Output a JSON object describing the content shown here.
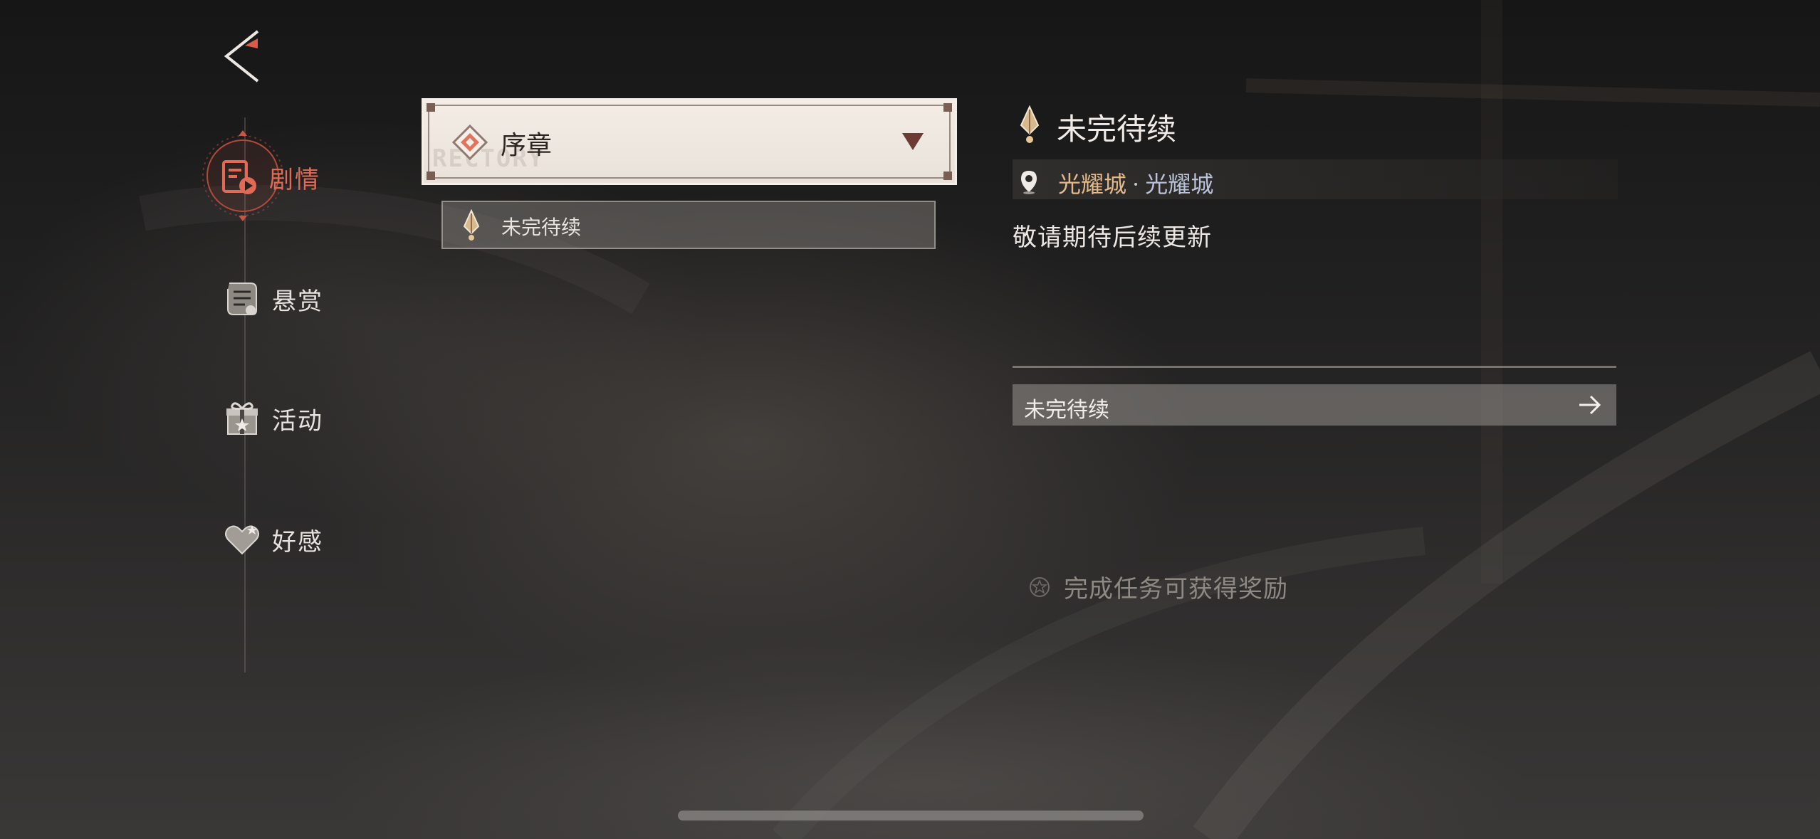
{
  "navigation": {
    "back_icon": "back-arrow-icon",
    "items": [
      {
        "id": "story",
        "label": "剧情",
        "icon": "story-book-icon",
        "active": true
      },
      {
        "id": "bounty",
        "label": "悬赏",
        "icon": "scroll-icon",
        "active": false
      },
      {
        "id": "event",
        "label": "活动",
        "icon": "gift-icon",
        "active": false
      },
      {
        "id": "affection",
        "label": "好感",
        "icon": "heart-icon",
        "active": false
      }
    ]
  },
  "chapter_select": {
    "selected": "序章",
    "watermark": "RECTORY"
  },
  "quest_list": [
    {
      "label": "未完待续",
      "icon": "quest-marker-icon",
      "selected": true
    }
  ],
  "detail": {
    "title": "未完待续",
    "location_primary": "光耀城",
    "location_separator": "·",
    "location_secondary": "光耀城",
    "description": "敬请期待后续更新",
    "goto_label": "未完待续",
    "reward_text": "完成任务可获得奖励"
  },
  "colors": {
    "accent": "#e06a55",
    "location_primary": "#e3b88a",
    "location_secondary": "#b9c2d6"
  }
}
